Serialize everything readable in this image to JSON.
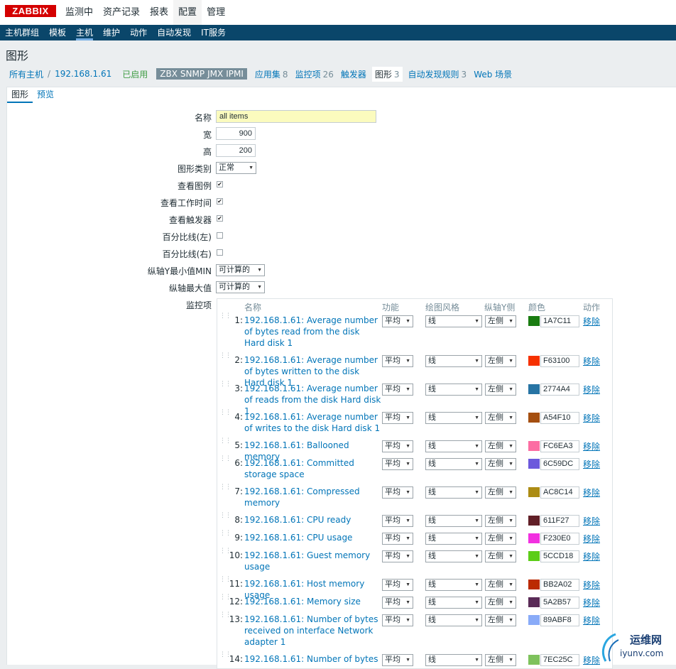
{
  "logo": "ZABBIX",
  "main_menu": [
    "监测中",
    "资产记录",
    "报表",
    "配置",
    "管理"
  ],
  "main_menu_active": 3,
  "sub_menu": [
    "主机群组",
    "模板",
    "主机",
    "维护",
    "动作",
    "自动发现",
    "IT服务"
  ],
  "sub_menu_active": 2,
  "page_title": "图形",
  "host_nav": {
    "all_hosts": "所有主机",
    "separator": "/",
    "host": "192.168.1.61",
    "status": "已启用",
    "interfaces": [
      "ZBX",
      "SNMP",
      "JMX",
      "IPMI"
    ],
    "applications": {
      "label": "应用集",
      "count": "8"
    },
    "items": {
      "label": "监控项",
      "count": "26"
    },
    "triggers": {
      "label": "触发器"
    },
    "graphs": {
      "label": "图形",
      "count": "3"
    },
    "discovery": {
      "label": "自动发现规则",
      "count": "3"
    },
    "web": {
      "label": "Web 场景"
    }
  },
  "form_tabs": [
    "图形",
    "预览"
  ],
  "form": {
    "name_label": "名称",
    "name_value": "all items",
    "width_label": "宽",
    "width_value": "900",
    "height_label": "高",
    "height_value": "200",
    "type_label": "图形类别",
    "type_value": "正常",
    "show_legend_label": "查看图例",
    "show_legend": true,
    "show_working_time_label": "查看工作时间",
    "show_working_time": true,
    "show_triggers_label": "查看触发器",
    "show_triggers": true,
    "percentile_left_label": "百分比线(左)",
    "percentile_left": false,
    "percentile_right_label": "百分比线(右)",
    "percentile_right": false,
    "ymin_label": "纵轴Y最小值MIN",
    "ymin_value": "可计算的",
    "ymax_label": "纵轴最大值",
    "ymax_value": "可计算的",
    "items_label": "监控项"
  },
  "items_table": {
    "headers": {
      "name": "名称",
      "function": "功能",
      "style": "绘图风格",
      "yaxis": "纵轴Y侧",
      "color": "颜色",
      "action": "动作"
    },
    "rows": [
      {
        "idx": "1:",
        "name": "192.168.1.61: Average number of bytes read from the disk Hard disk 1",
        "function": "平均",
        "style": "线",
        "yaxis": "左侧",
        "color": "1A7C11",
        "remove": "移除"
      },
      {
        "idx": "2:",
        "name": "192.168.1.61: Average number of bytes written to the disk Hard disk 1",
        "function": "平均",
        "style": "线",
        "yaxis": "左侧",
        "color": "F63100",
        "remove": "移除"
      },
      {
        "idx": "3:",
        "name": "192.168.1.61: Average number of reads from the disk Hard disk 1",
        "function": "平均",
        "style": "线",
        "yaxis": "左侧",
        "color": "2774A4",
        "remove": "移除"
      },
      {
        "idx": "4:",
        "name": "192.168.1.61: Average number of writes to the disk Hard disk 1",
        "function": "平均",
        "style": "线",
        "yaxis": "左侧",
        "color": "A54F10",
        "remove": "移除"
      },
      {
        "idx": "5:",
        "name": "192.168.1.61: Ballooned memory",
        "function": "平均",
        "style": "线",
        "yaxis": "左侧",
        "color": "FC6EA3",
        "remove": "移除"
      },
      {
        "idx": "6:",
        "name": "192.168.1.61: Committed storage space",
        "function": "平均",
        "style": "线",
        "yaxis": "左侧",
        "color": "6C59DC",
        "remove": "移除"
      },
      {
        "idx": "7:",
        "name": "192.168.1.61: Compressed memory",
        "function": "平均",
        "style": "线",
        "yaxis": "左侧",
        "color": "AC8C14",
        "remove": "移除"
      },
      {
        "idx": "8:",
        "name": "192.168.1.61: CPU ready",
        "function": "平均",
        "style": "线",
        "yaxis": "左侧",
        "color": "611F27",
        "remove": "移除"
      },
      {
        "idx": "9:",
        "name": "192.168.1.61: CPU usage",
        "function": "平均",
        "style": "线",
        "yaxis": "左侧",
        "color": "F230E0",
        "remove": "移除"
      },
      {
        "idx": "10:",
        "name": "192.168.1.61: Guest memory usage",
        "function": "平均",
        "style": "线",
        "yaxis": "左侧",
        "color": "5CCD18",
        "remove": "移除"
      },
      {
        "idx": "11:",
        "name": "192.168.1.61: Host memory usage",
        "function": "平均",
        "style": "线",
        "yaxis": "左侧",
        "color": "BB2A02",
        "remove": "移除"
      },
      {
        "idx": "12:",
        "name": "192.168.1.61: Memory size",
        "function": "平均",
        "style": "线",
        "yaxis": "左侧",
        "color": "5A2B57",
        "remove": "移除"
      },
      {
        "idx": "13:",
        "name": "192.168.1.61: Number of bytes received on interface Network adapter 1",
        "function": "平均",
        "style": "线",
        "yaxis": "左侧",
        "color": "89ABF8",
        "remove": "移除"
      },
      {
        "idx": "14:",
        "name": "192.168.1.61: Number of bytes",
        "function": "平均",
        "style": "线",
        "yaxis": "左侧",
        "color": "7EC25C",
        "remove": "移除"
      }
    ]
  },
  "watermark": {
    "text": "运维网",
    "url": "iyunv.com"
  }
}
